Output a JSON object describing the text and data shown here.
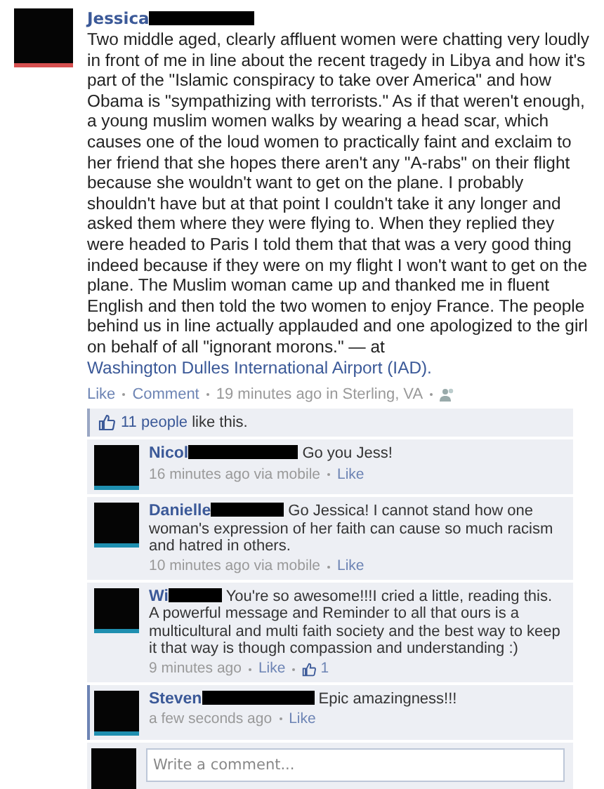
{
  "post": {
    "author": "Jessica",
    "text": "Two middle aged, clearly affluent women were chatting very loudly in front of me in line about the recent tragedy in Libya and how it's part of the \"Islamic conspiracy to take over America\" and how Obama is \"sympathizing with terrorists.\" As if that weren't enough, a young muslim women walks by wearing a head scar, which causes one of the loud women to practically faint and exclaim to her friend that she hopes there aren't any \"A-rabs\" on their flight because she wouldn't want to get on the plane. I probably shouldn't have but at that point I couldn't take it any longer and asked them where they were flying to. When they replied they were headed to Paris I told them that that was a very good thing indeed because if they were on my flight I won't want to get on the plane. The Muslim woman came up and thanked me in fluent English and then told the two women to enjoy France. The people behind us in line actually applauded and one apologized to the girl on behalf of all \"ignorant morons.\" — at",
    "place": "Washington Dulles International Airport (IAD).",
    "actions": [
      "Like",
      "Comment"
    ],
    "time": "19 minutes ago in Sterling, VA"
  },
  "likes": {
    "count": "11 people",
    "rest": "like this."
  },
  "comments": [
    {
      "author": "Nicol",
      "text": "Go you Jess!",
      "time": "16 minutes ago via mobile",
      "like": "Like",
      "new": false
    },
    {
      "author": "Danielle",
      "text": "Go Jessica! I cannot stand how one woman's expression of her faith can cause so much racism and hatred in others.",
      "time": "10 minutes ago via mobile",
      "like": "Like",
      "new": false
    },
    {
      "author": "Wi",
      "text": "You're so awesome!!!I cried a little, reading this. A powerful message and Reminder to all that ours is a multicultural and multi faith society and the best way to keep it that way is though compassion and understanding :)",
      "time": "9 minutes ago",
      "like": "Like",
      "like_count": "1",
      "new": false
    },
    {
      "author": "Steven",
      "text": "Epic amazingness!!!",
      "time": "a few seconds ago",
      "like": "Like",
      "new": true
    }
  ],
  "composer": {
    "placeholder": "Write a comment..."
  }
}
